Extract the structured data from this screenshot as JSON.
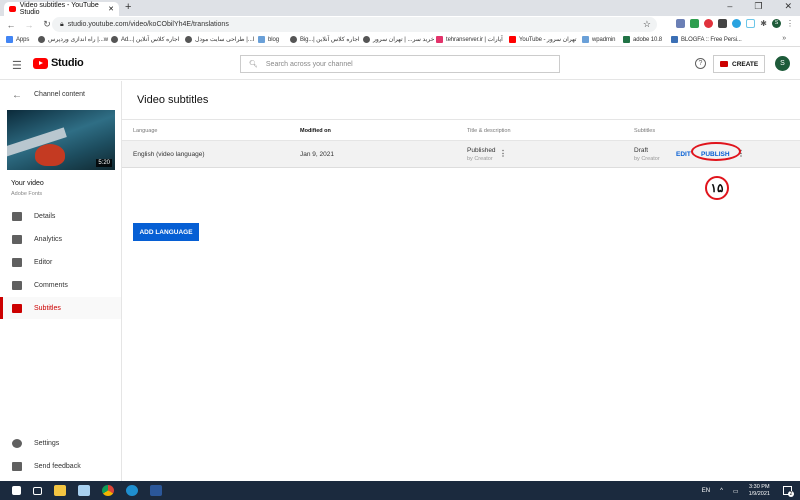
{
  "browser": {
    "tab_title": "Video subtitles - YouTube Studio",
    "url": "studio.youtube.com/video/koCObilYh4E/translations",
    "bookmarks": [
      "Apps",
      "راه اندازی وردپرس |...w",
      "Ad...| اجاره کلاس آنلاین",
      "ا...| طراحی سایت مودل",
      "blog",
      "Big...| اجاره کلاس آنلاین",
      "خرید سر... | تهران سرور",
      "tehranserver.ir | آپارات",
      "YouTube - تهران سرور",
      "wpadmin",
      "adobe 10.8",
      "BLOGFA :: Free Persi..."
    ],
    "profile_initial": "S"
  },
  "header": {
    "logo": "Studio",
    "search_placeholder": "Search across your channel",
    "create_label": "CREATE",
    "avatar": "S"
  },
  "sidebar": {
    "back_label": "Channel content",
    "video_duration": "5:20",
    "your_video": "Your video",
    "video_title": "Adobe Fonts",
    "items": [
      {
        "label": "Details"
      },
      {
        "label": "Analytics"
      },
      {
        "label": "Editor"
      },
      {
        "label": "Comments"
      },
      {
        "label": "Subtitles",
        "active": true
      }
    ],
    "settings": "Settings",
    "feedback": "Send feedback"
  },
  "main": {
    "title": "Video subtitles",
    "columns": [
      "Language",
      "Modified on",
      "Title & description",
      "Subtitles"
    ],
    "rows": [
      {
        "language": "English (video language)",
        "modified": "Jan 9, 2021",
        "title_status": "Published",
        "title_by": "by Creator",
        "sub_status": "Draft",
        "sub_by": "by Creator",
        "edit": "EDIT",
        "publish": "PUBLISH"
      }
    ],
    "annotation": "۱۵",
    "add_language": "ADD LANGUAGE"
  },
  "taskbar": {
    "lang": "EN",
    "time": "3:30 PM",
    "date": "1/9/2021",
    "notifications": "2"
  },
  "colors": {
    "accent": "#065fd4",
    "brand": "#ff0000",
    "annotation": "#e0141c"
  }
}
